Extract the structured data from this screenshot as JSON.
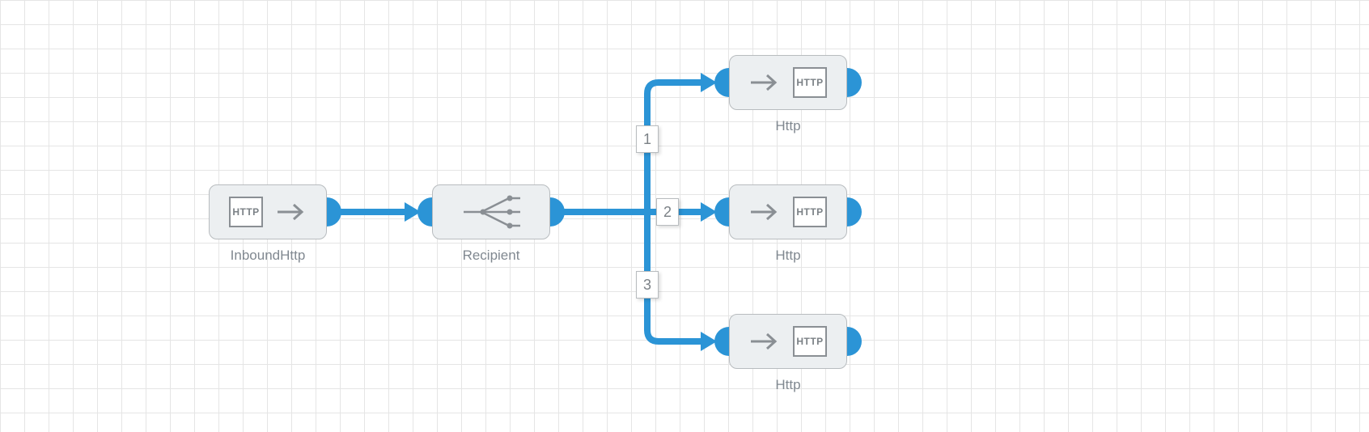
{
  "colors": {
    "wire": "#2b94d6",
    "node_fill": "#eceff1",
    "node_border": "#b8bcbf",
    "icon_stroke": "#8a8f94",
    "label_text": "#808890",
    "http_text": "#7b8186"
  },
  "nodes": {
    "inbound": {
      "label": "InboundHttp",
      "type": "http-in",
      "icon_text": "HTTP"
    },
    "recipient": {
      "label": "Recipient",
      "type": "router"
    },
    "http1": {
      "label": "Http",
      "type": "http-out",
      "icon_text": "HTTP"
    },
    "http2": {
      "label": "Http",
      "type": "http-out",
      "icon_text": "HTTP"
    },
    "http3": {
      "label": "Http",
      "type": "http-out",
      "icon_text": "HTTP"
    }
  },
  "branches": {
    "b1": "1",
    "b2": "2",
    "b3": "3"
  },
  "connections": [
    {
      "from": "inbound",
      "to": "recipient",
      "branch": null
    },
    {
      "from": "recipient",
      "to": "http1",
      "branch": "1"
    },
    {
      "from": "recipient",
      "to": "http2",
      "branch": "2"
    },
    {
      "from": "recipient",
      "to": "http3",
      "branch": "3"
    }
  ]
}
